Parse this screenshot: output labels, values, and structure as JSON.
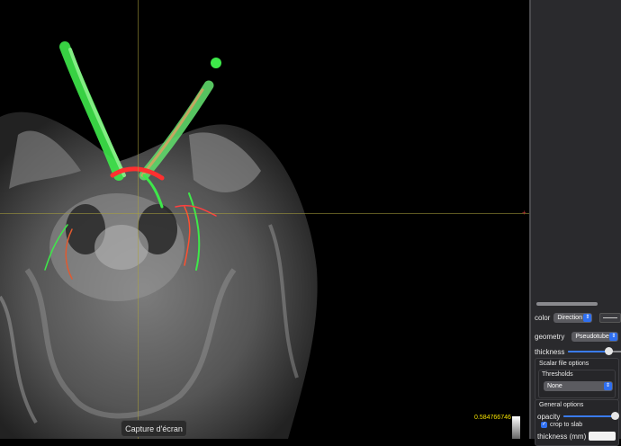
{
  "viewer": {
    "colorbar_max": "0.584766746",
    "screenshot_button": "Capture d'écran"
  },
  "panel": {
    "color_label": "color",
    "color_value": "Direction",
    "geometry_label": "geometry",
    "geometry_value": "Pseudotubes",
    "thickness_label": "thickness",
    "thickness_level": 0.75,
    "scalar_options": "Scalar file options",
    "thresholds": "Thresholds",
    "thresholds_value": "None",
    "general_options": "General options",
    "opacity_label": "opacity",
    "opacity_level": 0.95,
    "crop_label": "crop to slab",
    "crop_checked": true,
    "thickness_mm_label": "thickness (mm)"
  },
  "colors": {
    "accent": "#2f6ff0",
    "panel_bg": "#2a2a2d",
    "colorbar_text": "#f3e000"
  }
}
